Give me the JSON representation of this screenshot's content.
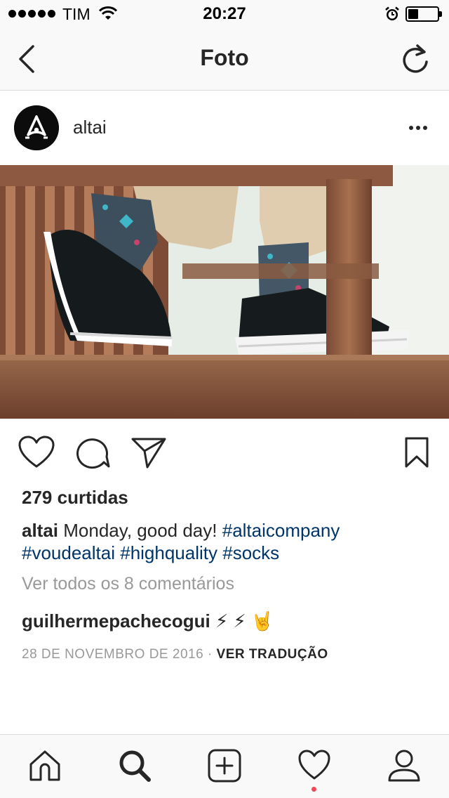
{
  "status_bar": {
    "carrier": "TIM",
    "time": "20:27"
  },
  "header": {
    "title": "Foto"
  },
  "post": {
    "username": "altai",
    "likes": "279 curtidas",
    "caption": {
      "username": "altai",
      "text": "Monday, good day!",
      "hashtags": [
        "#altaicompany",
        "#voudealtai",
        "#highquality",
        "#socks"
      ]
    },
    "view_comments": "Ver todos os 8 comentários",
    "comment": {
      "username": "guilhermepachecogui",
      "text": "⚡ ⚡ 🤘"
    },
    "date": "28 DE NOVEMBRO DE 2016",
    "separator": "·",
    "translate": "VER TRADUÇÃO"
  },
  "icons": {
    "back": "chevron-left-icon",
    "refresh": "refresh-icon",
    "more": "more-dots-icon",
    "like": "heart-icon",
    "comment": "comment-bubble-icon",
    "share": "paper-plane-icon",
    "save": "bookmark-icon",
    "tabs": [
      "home-icon",
      "search-icon",
      "add-post-icon",
      "activity-heart-icon",
      "profile-icon"
    ]
  },
  "colors": {
    "hashtag": "#003569",
    "muted": "#999999",
    "text": "#262626",
    "notification_dot": "#ed4956"
  }
}
